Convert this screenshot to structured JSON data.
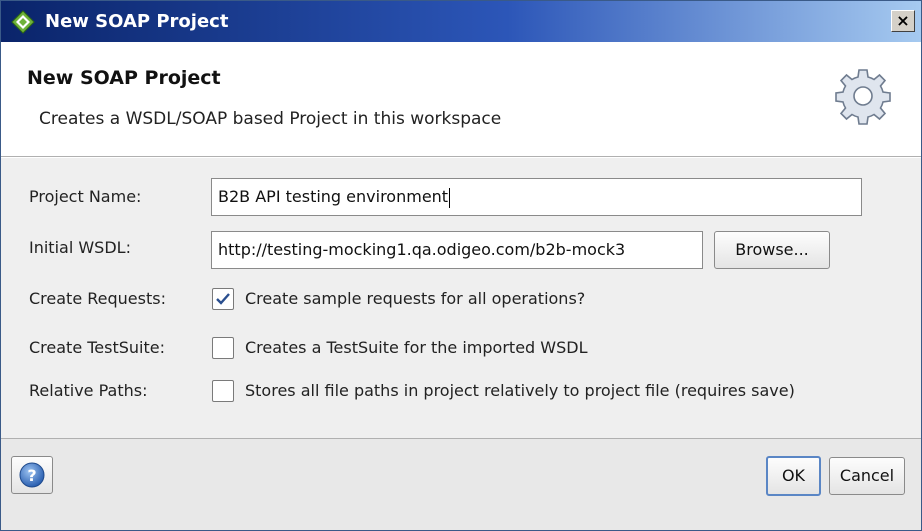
{
  "window": {
    "title": "New SOAP Project",
    "close_glyph": "×"
  },
  "header": {
    "title": "New SOAP Project",
    "description": "Creates a WSDL/SOAP based Project in this workspace",
    "icon": "gear-icon"
  },
  "form": {
    "project_name": {
      "label": "Project Name:",
      "value": "B2B API testing environment"
    },
    "initial_wsdl": {
      "label": "Initial WSDL:",
      "value": "http://testing-mocking1.qa.odigeo.com/b2b-mock3",
      "browse_label": "Browse..."
    },
    "create_requests": {
      "label": "Create Requests:",
      "checkbox_label": "Create sample requests for all operations?",
      "checked": true
    },
    "create_testsuite": {
      "label": "Create TestSuite:",
      "checkbox_label": "Creates a TestSuite for the imported WSDL",
      "checked": false
    },
    "relative_paths": {
      "label": "Relative Paths:",
      "checkbox_label": "Stores all file paths in project relatively to project file (requires save)",
      "checked": false
    }
  },
  "footer": {
    "help_icon": "help-icon",
    "ok_label": "OK",
    "cancel_label": "Cancel"
  },
  "colors": {
    "titlebar_start": "#0a246a",
    "titlebar_end": "#a6caf0",
    "form_bg": "#efefef",
    "default_button_border": "#5a86c5"
  }
}
